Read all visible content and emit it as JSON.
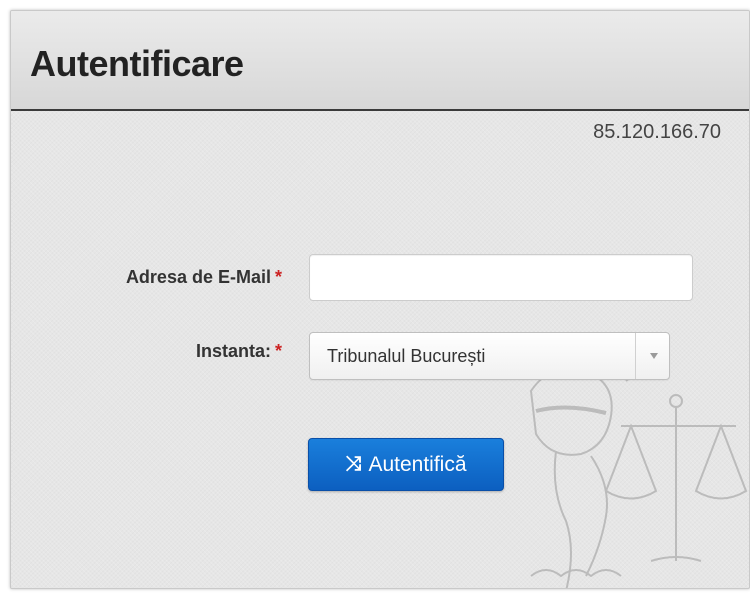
{
  "header": {
    "title": "Autentificare"
  },
  "client_ip": "85.120.166.70",
  "form": {
    "email": {
      "label": "Adresa de E-Mail",
      "required_marker": "*",
      "value": "",
      "placeholder": ""
    },
    "court": {
      "label": "Instanta:",
      "required_marker": "*",
      "selected": "Tribunalul București"
    },
    "submit": {
      "icon": "shuffle-icon",
      "icon_glyph": "⤨",
      "label": "Autentifică"
    }
  },
  "colors": {
    "button_primary": "#0c66cc",
    "required_marker": "#cc2222",
    "header_rule": "#3a3a3a"
  }
}
